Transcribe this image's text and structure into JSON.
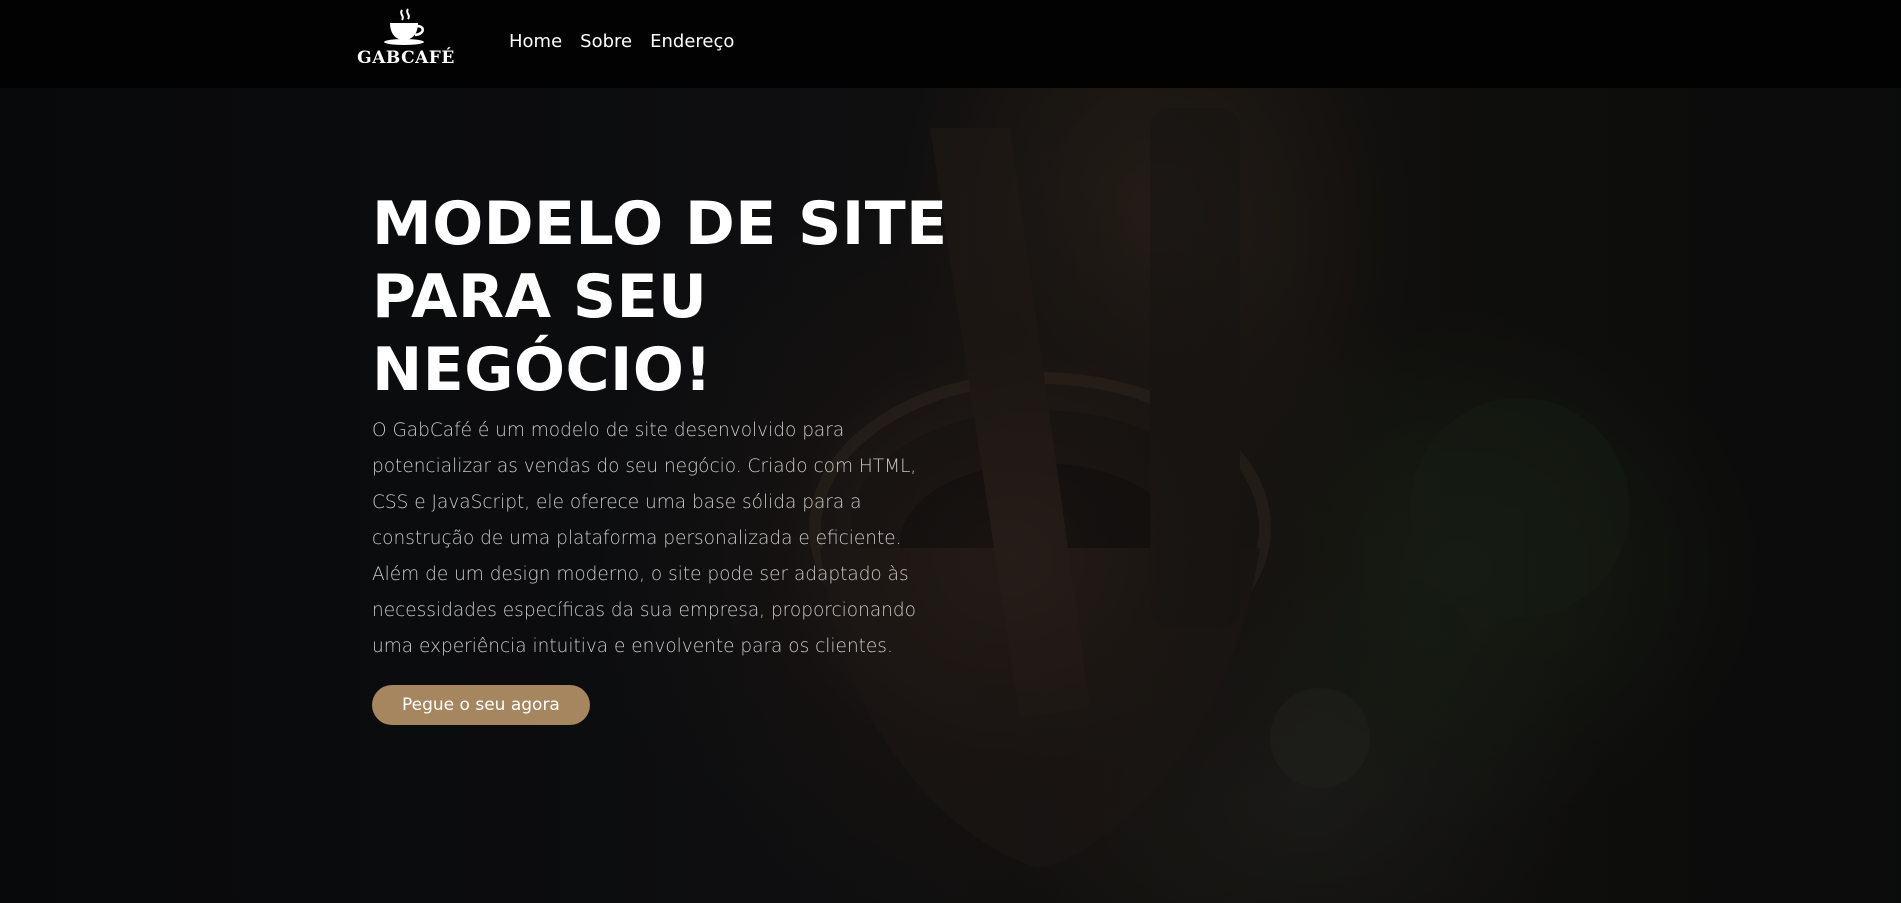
{
  "brand": {
    "name": "GABCAFÉ",
    "logo_icon": "coffee-cup-icon"
  },
  "nav": {
    "items": [
      {
        "label": "Home"
      },
      {
        "label": "Sobre"
      },
      {
        "label": "Endereço"
      }
    ]
  },
  "hero": {
    "title": "MODELO DE SITE PARA SEU NEGÓCIO!",
    "description": "O GabCafé é um modelo de site desenvolvido para potencializar as vendas do seu negócio. Criado com HTML, CSS e JavaScript, ele oferece uma base sólida para a construção de uma plataforma personalizada e eficiente. Além de um design moderno, o site pode ser adaptado às necessidades específicas da sua empresa, proporcionando uma experiência intuitiva e envolvente para os clientes.",
    "cta_label": "Pegue o seu agora"
  },
  "colors": {
    "navbar_bg": "#020202",
    "accent": "#a6865f",
    "text_primary": "#ffffff",
    "text_secondary": "#c9c9c9"
  }
}
